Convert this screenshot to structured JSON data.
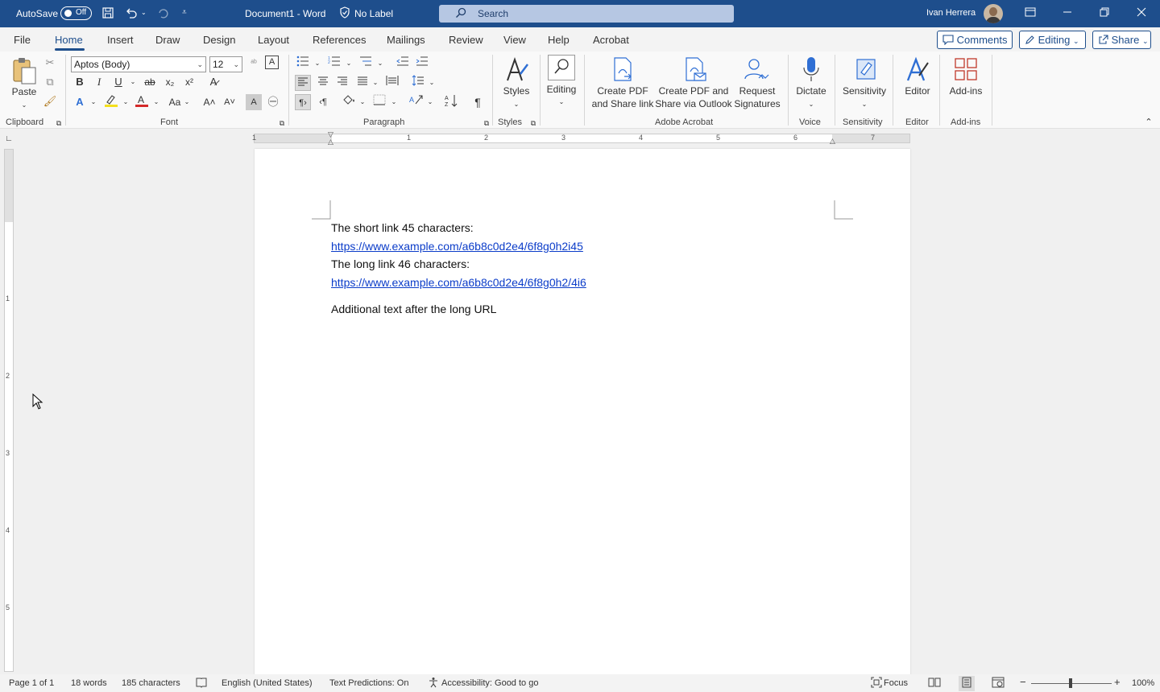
{
  "titlebar": {
    "autosave_label": "AutoSave",
    "autosave_state": "Off",
    "doc_title": "Document1  -  Word",
    "sensitivity_label": "No Label",
    "search_placeholder": "Search",
    "user_name": "Ivan Herrera"
  },
  "tabs": {
    "file": "File",
    "home": "Home",
    "insert": "Insert",
    "draw": "Draw",
    "design": "Design",
    "layout": "Layout",
    "references": "References",
    "mailings": "Mailings",
    "review": "Review",
    "view": "View",
    "help": "Help",
    "acrobat": "Acrobat",
    "comments": "Comments",
    "editing": "Editing",
    "share": "Share"
  },
  "ribbon": {
    "paste": "Paste",
    "font_name": "Aptos (Body)",
    "font_size": "12",
    "styles": "Styles",
    "editing": "Editing",
    "create_pdf_share_line1": "Create PDF",
    "create_pdf_share_line2": "and Share link",
    "create_pdf_outlook_line1": "Create PDF and",
    "create_pdf_outlook_line2": "Share via Outlook",
    "request_sign_line1": "Request",
    "request_sign_line2": "Signatures",
    "dictate": "Dictate",
    "sensitivity": "Sensitivity",
    "editor": "Editor",
    "addins": "Add-ins",
    "groups": {
      "clipboard": "Clipboard",
      "font": "Font",
      "paragraph": "Paragraph",
      "styles": "Styles",
      "adobe_acrobat": "Adobe Acrobat",
      "voice": "Voice",
      "sensitivity": "Sensitivity",
      "editor": "Editor",
      "addins": "Add-ins"
    }
  },
  "ruler": {
    "h_numbers": [
      "1",
      "1",
      "2",
      "3",
      "4",
      "5",
      "6",
      "7"
    ],
    "v_numbers": [
      "1",
      "2",
      "3",
      "4",
      "5"
    ]
  },
  "document": {
    "line1": "The short link 45 characters:",
    "link1": "https://www.example.com/a6b8c0d2e4/6f8g0h2i45",
    "line2": "The long link 46 characters:",
    "link2": "https://www.example.com/a6b8c0d2e4/6f8g0h2/4i6",
    "line3": "Additional text after the long URL"
  },
  "status": {
    "page": "Page 1 of 1",
    "words": "18 words",
    "characters": "185 characters",
    "language": "English (United States)",
    "text_predictions": "Text Predictions: On",
    "accessibility": "Accessibility: Good to go",
    "focus": "Focus",
    "zoom": "100%"
  }
}
